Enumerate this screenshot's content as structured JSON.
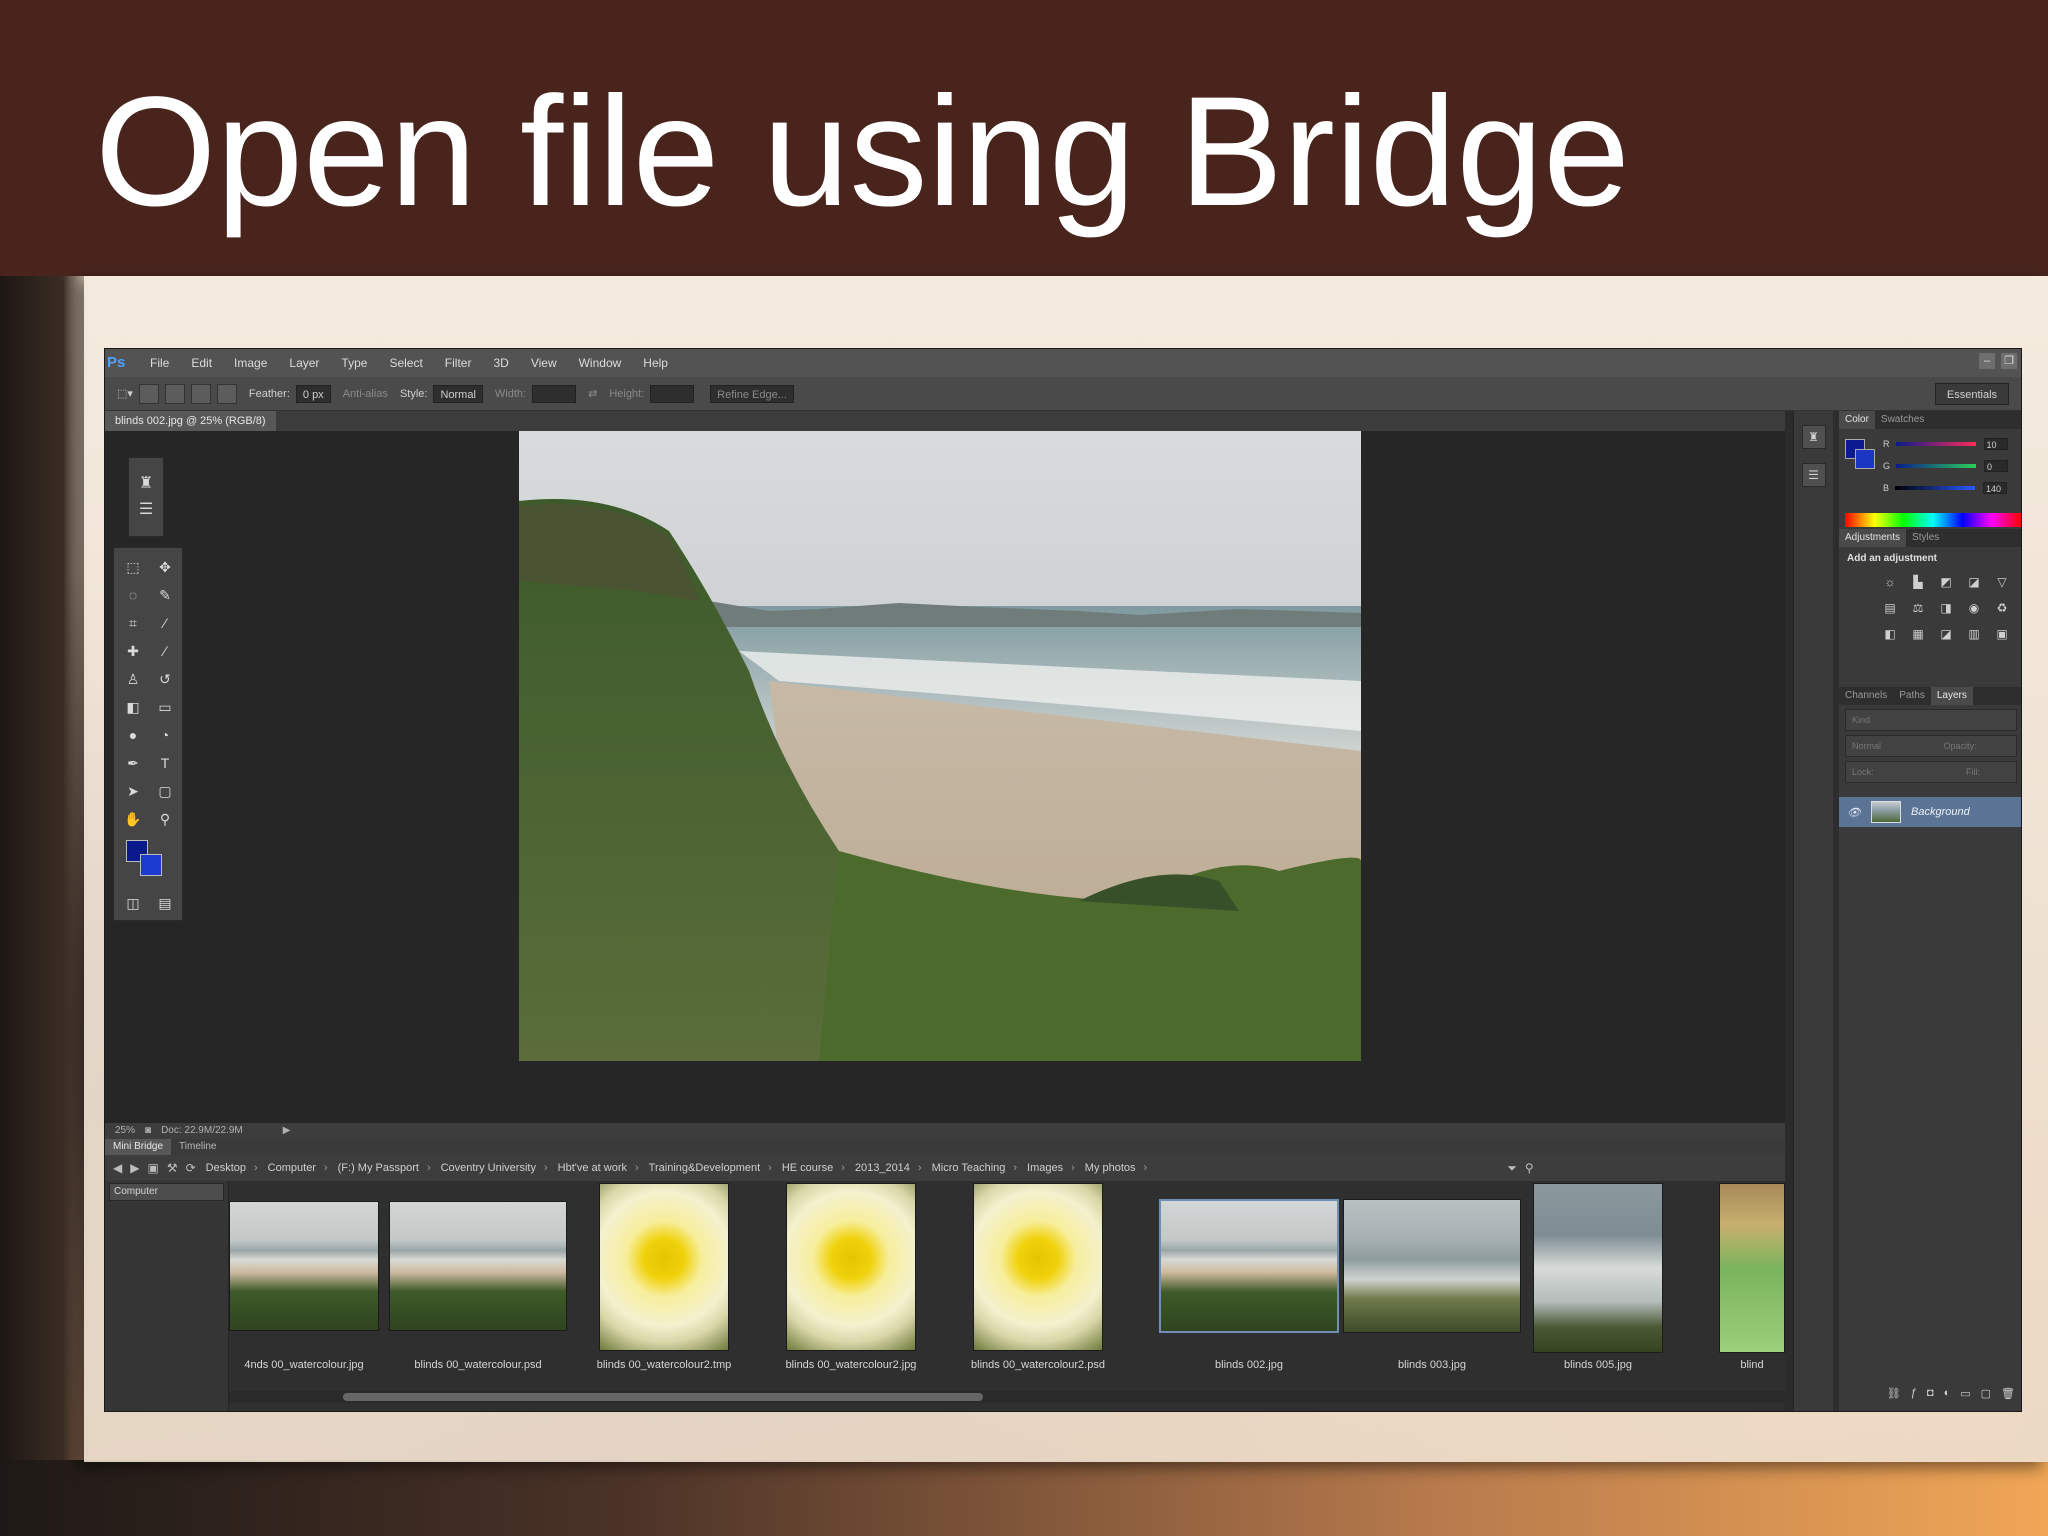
{
  "slide": {
    "title": "Open file using Bridge"
  },
  "photoshop": {
    "logo": "Ps",
    "menu": [
      "File",
      "Edit",
      "Image",
      "Layer",
      "Type",
      "Select",
      "Filter",
      "3D",
      "View",
      "Window",
      "Help"
    ],
    "options_bar": {
      "feather_label": "Feather:",
      "feather_value": "0 px",
      "antialias_label": "Anti-alias",
      "style_label": "Style:",
      "style_value": "Normal",
      "width_label": "Width:",
      "height_label": "Height:",
      "refine_button": "Refine Edge..."
    },
    "workspace": "Essentials",
    "document_tab": "blinds 002.jpg @ 25% (RGB/8)",
    "status": {
      "zoom": "25%",
      "doc": "Doc: 22.9M/22.9M"
    },
    "colors": {
      "foreground": "#0a1a8c",
      "background": "#1a3ad0",
      "accent": "#5b7394"
    }
  },
  "mini_bridge": {
    "tabs": [
      "Mini Bridge",
      "Timeline"
    ],
    "breadcrumbs": [
      "Desktop",
      "Computer",
      "(F:) My Passport",
      "Coventry University",
      "Hbt've at work",
      "Training&Development",
      "HE course",
      "2013_2014",
      "Micro Teaching",
      "Images",
      "My photos"
    ],
    "location_select": "Computer",
    "files": [
      {
        "name": "4nds 00_watercolour.jpg",
        "kind": "beach"
      },
      {
        "name": "blinds 00_watercolour.psd",
        "kind": "beach"
      },
      {
        "name": "blinds 00_watercolour2.tmp",
        "kind": "daffodil"
      },
      {
        "name": "blinds 00_watercolour2.jpg",
        "kind": "daffodil"
      },
      {
        "name": "blinds 00_watercolour2.psd",
        "kind": "daffodil"
      },
      {
        "name": "blinds 002.jpg",
        "kind": "beach",
        "selected": true
      },
      {
        "name": "blinds 003.jpg",
        "kind": "sea"
      },
      {
        "name": "blinds 005.jpg",
        "kind": "waves"
      },
      {
        "name": "blind",
        "kind": "green"
      }
    ]
  },
  "panels": {
    "color_tabs": [
      "Color",
      "Swatches"
    ],
    "color_values": {
      "r": "10",
      "g": "0",
      "b": "140"
    },
    "adjust_tabs": [
      "Adjustments",
      "Styles"
    ],
    "adjust_heading": "Add an adjustment",
    "layer_tabs": [
      "Channels",
      "Paths",
      "Layers"
    ],
    "layers_kind": "Kind",
    "blend_mode": "Normal",
    "opacity_label": "Opacity:",
    "lock_label": "Lock:",
    "fill_label": "Fill:",
    "layer_name": "Background"
  }
}
